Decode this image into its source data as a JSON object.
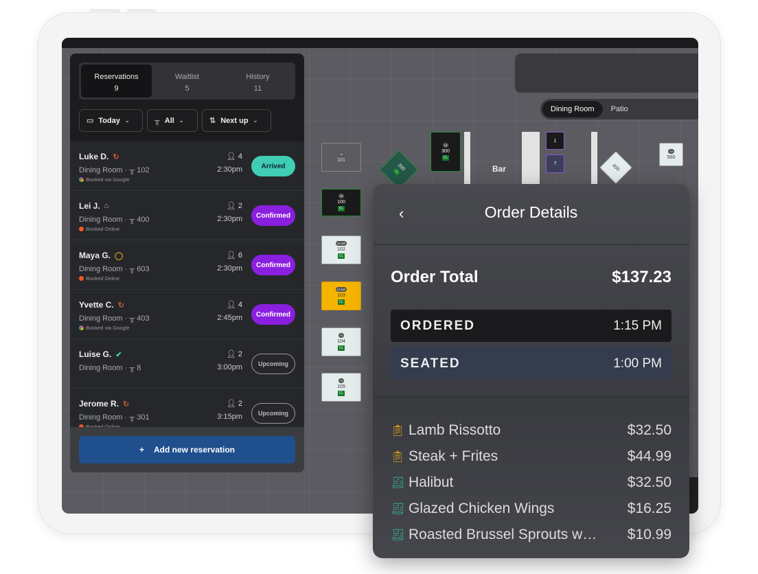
{
  "tabs": [
    {
      "label": "Reservations",
      "count": "9"
    },
    {
      "label": "Waitlist",
      "count": "5"
    },
    {
      "label": "History",
      "count": "11"
    }
  ],
  "filters": {
    "date": "Today",
    "tables": "All",
    "sort": "Next up"
  },
  "reservations": [
    {
      "name": "Luke D.",
      "room": "Dining Room ·",
      "table": "102",
      "party": "4",
      "time": "2:30pm",
      "source": "Booked via Google",
      "status": "Arrived",
      "tag_icon": "repeat-icon"
    },
    {
      "name": "Lei J.",
      "room": "Dining Room ·",
      "table": "400",
      "party": "2",
      "time": "2:30pm",
      "source": "Booked Online",
      "status": "Confirmed",
      "tag_icon": "cake-icon"
    },
    {
      "name": "Maya G.",
      "room": "Dining Room ·",
      "table": "603",
      "party": "6",
      "time": "2:30pm",
      "source": "Booked Online",
      "status": "Confirmed",
      "tag_icon": "chat-icon"
    },
    {
      "name": "Yvette C.",
      "room": "Dining Room ·",
      "table": "403",
      "party": "4",
      "time": "2:45pm",
      "source": "Booked via Google",
      "status": "Confirmed",
      "tag_icon": "repeat-icon"
    },
    {
      "name": "Luise G.",
      "room": "Dining Room ·",
      "table": "8",
      "party": "2",
      "time": "3:00pm",
      "source": "",
      "status": "Upcoming",
      "tag_icon": "verified-icon"
    },
    {
      "name": "Jerome R.",
      "room": "Dining Room ·",
      "table": "301",
      "party": "2",
      "time": "3:15pm",
      "source": "Booked Online",
      "status": "Upcoming",
      "tag_icon": "repeat-icon"
    }
  ],
  "add_button": "Add new reservation",
  "rooms": [
    "Dining Room",
    "Patio"
  ],
  "floor": {
    "bar_label": "Bar",
    "tables": [
      "101",
      "200",
      "300",
      "100",
      "102",
      "103",
      "104",
      "105",
      "1",
      "7",
      "400",
      "500"
    ],
    "badge": "CL"
  },
  "order": {
    "title": "Order Details",
    "total_label": "Order Total",
    "total": "$137.23",
    "ordered_label": "ORDERED",
    "ordered_time": "1:15 PM",
    "seated_label": "SEATED",
    "seated_time": "1:00 PM",
    "items": [
      {
        "name": "Lamb Rissotto",
        "price": "$32.50",
        "state": "sent"
      },
      {
        "name": "Steak + Frites",
        "price": "$44.99",
        "state": "sent"
      },
      {
        "name": "Halibut",
        "price": "$32.50",
        "state": "served"
      },
      {
        "name": "Glazed Chicken Wings",
        "price": "$16.25",
        "state": "served"
      },
      {
        "name": "Roasted Brussel Sprouts w…",
        "price": "$10.99",
        "state": "served"
      }
    ]
  },
  "colors": {
    "arrived": "#3fcdb4",
    "confirmed": "#8a1fe0",
    "primary": "#1f4f8d",
    "sent": "#e8a812",
    "served": "#2fbfa5"
  }
}
